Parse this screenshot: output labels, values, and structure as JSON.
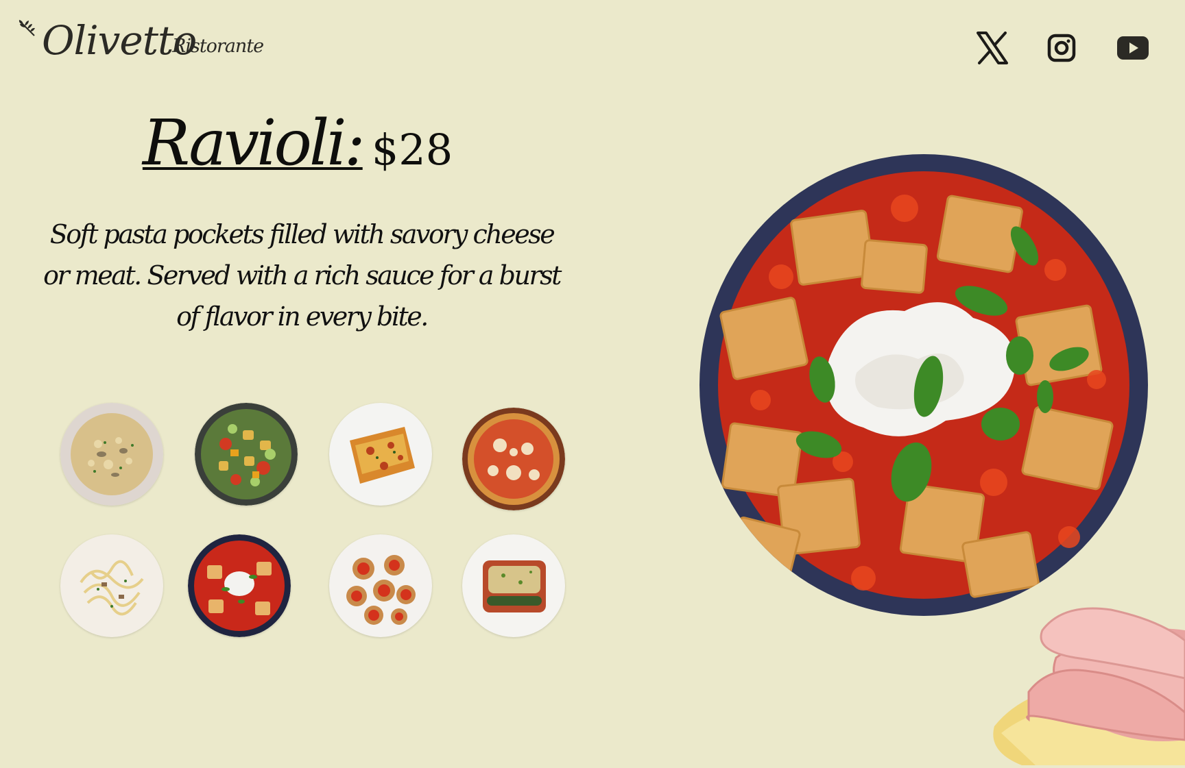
{
  "brand": {
    "name": "Olivetto",
    "subtitle": "Ristorante",
    "logo_icon": "olive-branch-icon"
  },
  "social": [
    {
      "name": "x",
      "icon": "x-logo-icon"
    },
    {
      "name": "instagram",
      "icon": "instagram-icon"
    },
    {
      "name": "youtube",
      "icon": "youtube-icon"
    }
  ],
  "dish": {
    "title": "Ravioli:",
    "price": "$28",
    "description": "Soft pasta pockets filled with savory cheese or meat. Served with a rich sauce for a burst of flavor in every bite."
  },
  "menu_thumbnails": [
    "risotto",
    "panzanella-salad",
    "lasagna",
    "pizza",
    "spaghetti-carbonara",
    "ravioli",
    "bruschetta",
    "cannelloni"
  ],
  "colors": {
    "background": "#ebe9cb",
    "text": "#1c1b18",
    "sauce": "#c9281a",
    "basil": "#3d8a26"
  }
}
